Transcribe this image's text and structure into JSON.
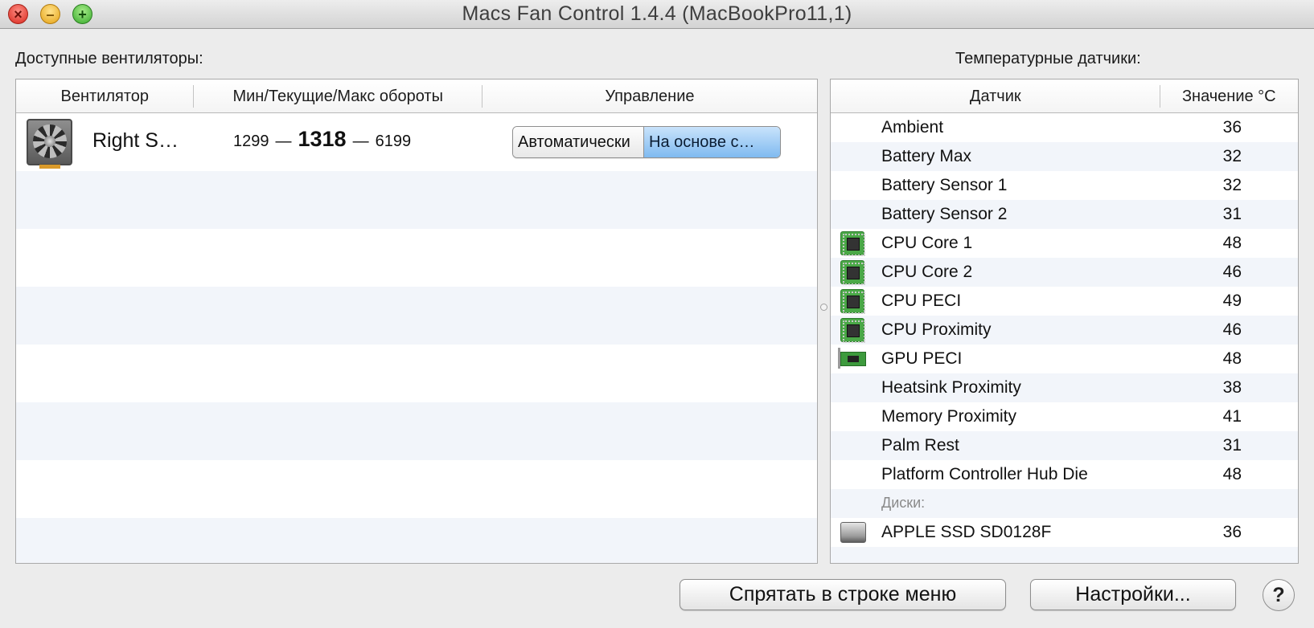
{
  "window": {
    "title": "Macs Fan Control 1.4.4 (MacBookPro11,1)",
    "close_glyph": "×",
    "minimize_glyph": "–",
    "zoom_glyph": "+"
  },
  "fans": {
    "section_label": "Доступные вентиляторы:",
    "columns": {
      "fan": "Вентилятор",
      "rpm": "Мин/Текущие/Макс обороты",
      "control": "Управление"
    },
    "rows": [
      {
        "icon": "fan-icon",
        "name": "Right S…",
        "min": "1299",
        "current": "1318",
        "max": "6199",
        "dash": "—",
        "control_auto": "Автоматически",
        "control_sensor": "На основе с…",
        "selected_control": "sensor"
      }
    ]
  },
  "sensors": {
    "section_label": "Температурные датчики:",
    "columns": {
      "name": "Датчик",
      "value": "Значение °C"
    },
    "rows": [
      {
        "icon": "",
        "name": "Ambient",
        "value": "36"
      },
      {
        "icon": "",
        "name": "Battery Max",
        "value": "32"
      },
      {
        "icon": "",
        "name": "Battery Sensor 1",
        "value": "32"
      },
      {
        "icon": "",
        "name": "Battery Sensor 2",
        "value": "31"
      },
      {
        "icon": "cpu-chip-icon",
        "name": "CPU Core 1",
        "value": "48"
      },
      {
        "icon": "cpu-chip-icon",
        "name": "CPU Core 2",
        "value": "46"
      },
      {
        "icon": "cpu-chip-icon",
        "name": "CPU PECI",
        "value": "49"
      },
      {
        "icon": "cpu-chip-icon",
        "name": "CPU Proximity",
        "value": "46"
      },
      {
        "icon": "gpu-card-icon",
        "name": "GPU PECI",
        "value": "48"
      },
      {
        "icon": "",
        "name": "Heatsink Proximity",
        "value": "38"
      },
      {
        "icon": "",
        "name": "Memory Proximity",
        "value": "41"
      },
      {
        "icon": "",
        "name": "Palm Rest",
        "value": "31"
      },
      {
        "icon": "",
        "name": "Platform Controller Hub Die",
        "value": "48"
      }
    ],
    "disks_group_label": "Диски:",
    "disks": [
      {
        "icon": "disk-drive-icon",
        "name": "APPLE SSD SD0128F",
        "value": "36"
      }
    ]
  },
  "buttons": {
    "hide_in_menu_bar": "Спрятать в строке меню",
    "settings": "Настройки...",
    "help": "?"
  }
}
